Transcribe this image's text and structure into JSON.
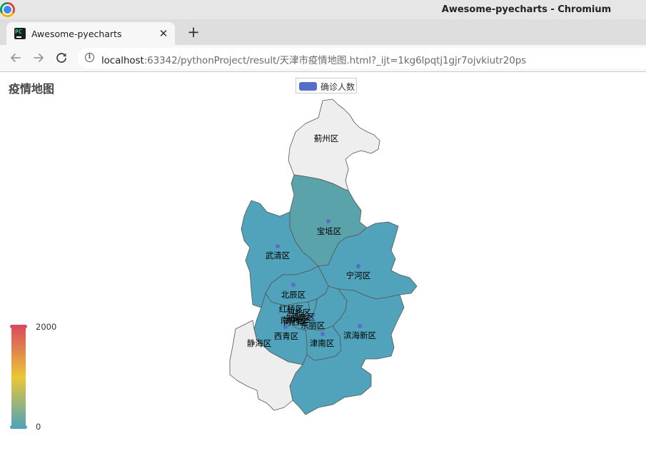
{
  "window": {
    "title": "Awesome-pyecharts - Chromium"
  },
  "tab": {
    "title": "Awesome-pyecharts",
    "favicon": "pycharm-icon"
  },
  "address_bar": {
    "host": "localhost",
    "path": ":63342/pythonProject/result/天津市疫情地图.html?_ijt=1kg6lpqtj1gjr7ojvkiutr20ps"
  },
  "chart_title": "疫情地图",
  "legend": {
    "series_name": "确诊人数",
    "color": "#5470c6"
  },
  "visual_map": {
    "max_label": "2000",
    "min_label": "0",
    "min": 0,
    "max": 2000,
    "colors": [
      "#50a3ba",
      "#eac736",
      "#d94e5d"
    ]
  },
  "map": {
    "no_data_color": "#eeeeee",
    "regions": [
      {
        "name": "蓟州区",
        "has_data": false
      },
      {
        "name": "宝坻区",
        "has_data": true
      },
      {
        "name": "武清区",
        "has_data": true
      },
      {
        "name": "宁河区",
        "has_data": true
      },
      {
        "name": "北辰区",
        "has_data": true
      },
      {
        "name": "红桥区",
        "has_data": true
      },
      {
        "name": "河北区",
        "has_data": true
      },
      {
        "name": "河东区",
        "has_data": true
      },
      {
        "name": "南开区",
        "has_data": true
      },
      {
        "name": "和平区",
        "has_data": true
      },
      {
        "name": "河西区",
        "has_data": true
      },
      {
        "name": "东丽区",
        "has_data": true
      },
      {
        "name": "西青区",
        "has_data": true
      },
      {
        "name": "津南区",
        "has_data": true
      },
      {
        "name": "滨海新区",
        "has_data": true
      },
      {
        "name": "静海区",
        "has_data": false
      }
    ]
  }
}
